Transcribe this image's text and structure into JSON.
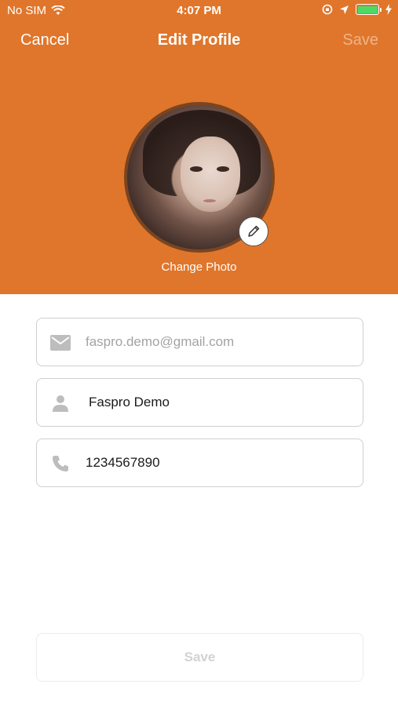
{
  "status_bar": {
    "carrier": "No SIM",
    "time": "4:07 PM",
    "battery_level": 1.0,
    "battery_color": "#4cd964"
  },
  "nav": {
    "cancel": "Cancel",
    "title": "Edit Profile",
    "save": "Save"
  },
  "profile": {
    "change_photo": "Change Photo"
  },
  "form": {
    "email_placeholder": "faspro.demo@gmail.com",
    "name_value": "Faspro Demo",
    "phone_value": "1234567890"
  },
  "actions": {
    "save": "Save"
  },
  "theme": {
    "accent": "#e0762b"
  },
  "icons": [
    "wifi-icon",
    "location-icon",
    "orientation-lock-icon",
    "battery-icon",
    "charging-icon",
    "pencil-icon",
    "mail-icon",
    "person-icon",
    "phone-icon"
  ]
}
